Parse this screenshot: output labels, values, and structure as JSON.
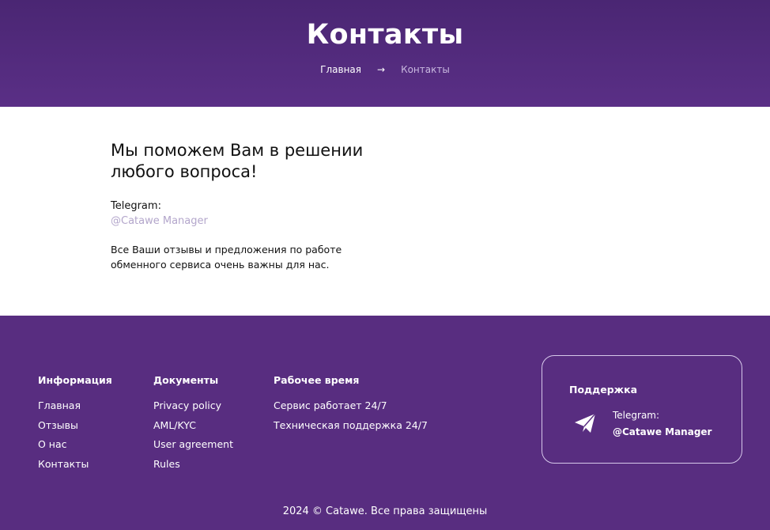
{
  "hero": {
    "title": "Контакты",
    "breadcrumb": {
      "home": "Главная",
      "separator": "→",
      "current": "Контакты"
    }
  },
  "main": {
    "heading": "Мы поможем Вам в решении любого вопроса!",
    "telegram_label": "Telegram:",
    "telegram_handle": "@Catawe Manager",
    "note": "Все Ваши отзывы и предложения по работе обменного сервиса очень важны для нас."
  },
  "footer": {
    "info": {
      "title": "Информация",
      "links": [
        "Главная",
        "Отзывы",
        "О нас",
        "Контакты"
      ]
    },
    "docs": {
      "title": "Документы",
      "links": [
        "Privacy policy",
        "AML/KYC",
        "User agreement",
        "Rules"
      ]
    },
    "hours": {
      "title": "Рабочее время",
      "lines": [
        "Сервис работает 24/7",
        "Техническая поддержка 24/7"
      ]
    },
    "support": {
      "title": "Поддержка",
      "icon": "telegram-plane-icon",
      "label": "Telegram:",
      "handle": "@Catawe Manager"
    },
    "copyright": "2024 © Catawe. Все права защищены"
  },
  "colors": {
    "primary": "#582d80",
    "hero_top": "#4a2673",
    "link_muted": "#b3a6cb"
  }
}
